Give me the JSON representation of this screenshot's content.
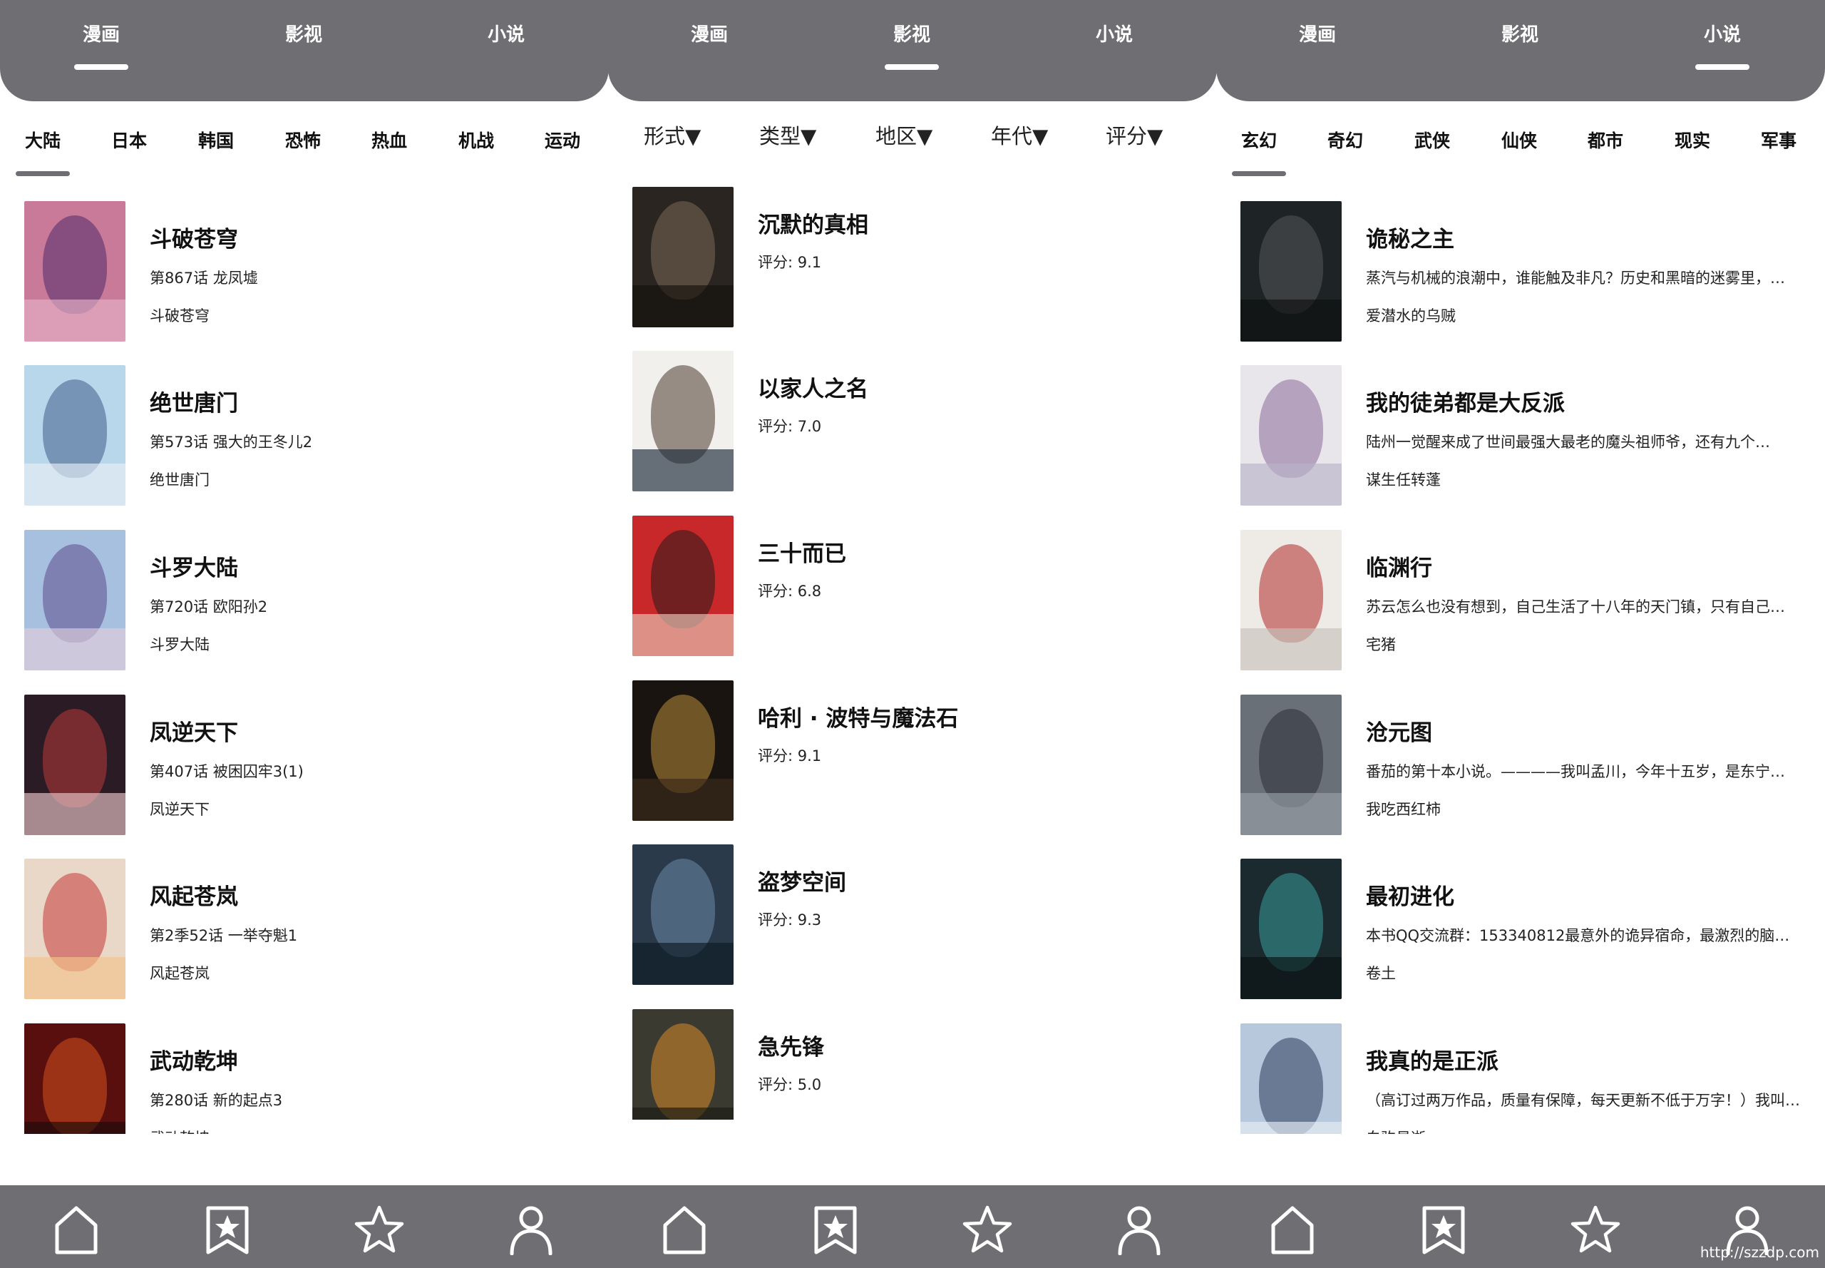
{
  "top_tabs": [
    "漫画",
    "影视",
    "小说"
  ],
  "manhua": {
    "active_top_tab": 0,
    "categories": [
      "大陆",
      "日本",
      "韩国",
      "恐怖",
      "热血",
      "机战",
      "运动"
    ],
    "items": [
      {
        "title": "斗破苍穹",
        "chapter": "第867话 龙凤墟",
        "name": "斗破苍穹",
        "colors": [
          "#c97a98",
          "#4c2a6a",
          "#e6b2c8"
        ]
      },
      {
        "title": "绝世唐门",
        "chapter": "第573话 强大的王冬儿2",
        "name": "绝世唐门",
        "colors": [
          "#b9d7ea",
          "#3f5f8a",
          "#e8eef6"
        ]
      },
      {
        "title": "斗罗大陆",
        "chapter": "第720话 欧阳孙2",
        "name": "斗罗大陆",
        "colors": [
          "#a8c0df",
          "#5a4a8a",
          "#e1ccd8"
        ]
      },
      {
        "title": "凤逆天下",
        "chapter": "第407话 被困囚牢3(1)",
        "name": "凤逆天下",
        "colors": [
          "#2b1b24",
          "#b83a3a",
          "#e9c6c9"
        ]
      },
      {
        "title": "风起苍岚",
        "chapter": "第2季52话 一举夺魁1",
        "name": "风起苍岚",
        "colors": [
          "#e9d7c7",
          "#c53a38",
          "#f2c28a"
        ]
      },
      {
        "title": "武动乾坤",
        "chapter": "第280话 新的起点3",
        "name": "武动乾坤",
        "colors": [
          "#5a0f0f",
          "#d4521e",
          "#1a0a0a"
        ]
      }
    ]
  },
  "video": {
    "active_top_tab": 1,
    "filters": [
      "形式▼",
      "类型▼",
      "地区▼",
      "年代▼",
      "评分▼"
    ],
    "items": [
      {
        "title": "沉默的真相",
        "rating": "评分: 9.1",
        "colors": [
          "#2a2520",
          "#7a6a58",
          "#14110e"
        ]
      },
      {
        "title": "以家人之名",
        "rating": "评分: 7.0",
        "colors": [
          "#f2f0ec",
          "#4a3a30",
          "#1a2a3a"
        ]
      },
      {
        "title": "三十而已",
        "rating": "评分: 6.8",
        "colors": [
          "#c8282a",
          "#2a1a1a",
          "#e8c8b8"
        ]
      },
      {
        "title": "哈利 · 波特与魔法石",
        "rating": "评分: 9.1",
        "colors": [
          "#1a1410",
          "#b88a3a",
          "#3a2a1a"
        ]
      },
      {
        "title": "盗梦空间",
        "rating": "评分: 9.3",
        "colors": [
          "#2a3a4a",
          "#6a8aa8",
          "#0e1a24"
        ]
      },
      {
        "title": "急先锋",
        "rating": "评分: 5.0",
        "colors": [
          "#3a3a30",
          "#d88a2a",
          "#1a1a14"
        ]
      }
    ]
  },
  "novel": {
    "active_top_tab": 2,
    "categories": [
      "玄幻",
      "奇幻",
      "武侠",
      "仙侠",
      "都市",
      "现实",
      "军事"
    ],
    "items": [
      {
        "title": "诡秘之主",
        "desc": "蒸汽与机械的浪潮中，谁能触及非凡？历史和黑暗的迷雾里，…",
        "author": "爱潜水的乌贼",
        "colors": [
          "#1e2326",
          "#55585a",
          "#0e0f10"
        ]
      },
      {
        "title": "我的徒弟都是大反派",
        "desc": "陆州一觉醒来成了世间最强大最老的魔头祖师爷，还有九个…",
        "author": "谋生任转蓬",
        "colors": [
          "#e8e6ea",
          "#8a6a9a",
          "#b8b4c8"
        ]
      },
      {
        "title": "临渊行",
        "desc": "苏云怎么也没有想到，自己生活了十八年的天门镇，只有自己…",
        "author": "宅猪",
        "colors": [
          "#eeeae6",
          "#b02a2a",
          "#c8c2bc"
        ]
      },
      {
        "title": "沧元图",
        "desc": "番茄的第十本小说。————我叫孟川，今年十五岁，是东宁…",
        "author": "我吃西红柿",
        "colors": [
          "#6a7078",
          "#2a2e34",
          "#9aa0a8"
        ]
      },
      {
        "title": "最初进化",
        "desc": "本书QQ交流群：153340812最意外的诡异宿命，最激烈的脑…",
        "author": "卷土",
        "colors": [
          "#1a2a2e",
          "#3a9a9a",
          "#0a1214"
        ]
      },
      {
        "title": "我真的是正派",
        "desc": "（高订过两万作品，质量有保障，每天更新不低于万字！）我叫…",
        "author": "白驹易逝",
        "colors": [
          "#b8c8dc",
          "#2a3a5a",
          "#e8eef4"
        ]
      }
    ]
  },
  "bottom_nav": [
    {
      "icon": "home-icon"
    },
    {
      "icon": "bookmark-star-icon"
    },
    {
      "icon": "star-icon"
    },
    {
      "icon": "user-icon"
    }
  ],
  "watermark": "http://szzdp.com"
}
